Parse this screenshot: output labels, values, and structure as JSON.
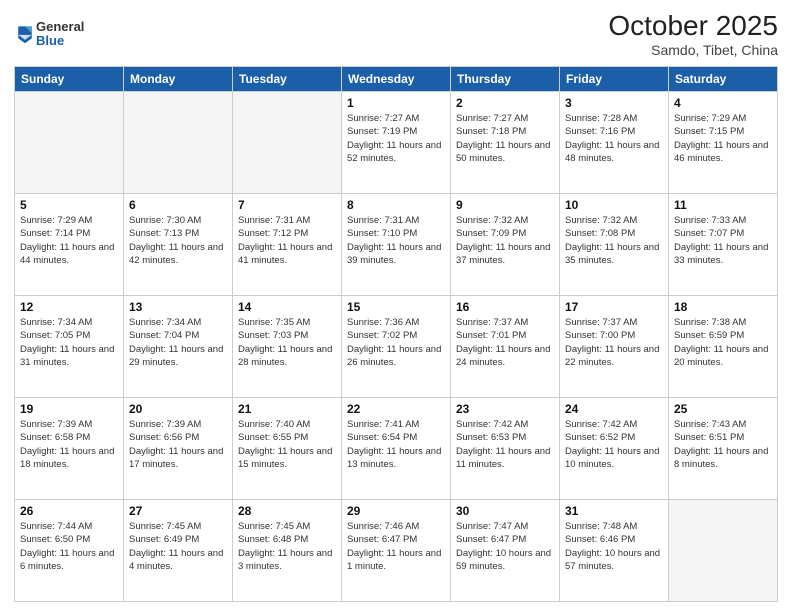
{
  "logo": {
    "general": "General",
    "blue": "Blue"
  },
  "header": {
    "month": "October 2025",
    "location": "Samdo, Tibet, China"
  },
  "weekdays": [
    "Sunday",
    "Monday",
    "Tuesday",
    "Wednesday",
    "Thursday",
    "Friday",
    "Saturday"
  ],
  "weeks": [
    [
      {
        "day": "",
        "empty": true
      },
      {
        "day": "",
        "empty": true
      },
      {
        "day": "",
        "empty": true
      },
      {
        "day": "1",
        "sunrise": "7:27 AM",
        "sunset": "7:19 PM",
        "daylight": "11 hours and 52 minutes."
      },
      {
        "day": "2",
        "sunrise": "7:27 AM",
        "sunset": "7:18 PM",
        "daylight": "11 hours and 50 minutes."
      },
      {
        "day": "3",
        "sunrise": "7:28 AM",
        "sunset": "7:16 PM",
        "daylight": "11 hours and 48 minutes."
      },
      {
        "day": "4",
        "sunrise": "7:29 AM",
        "sunset": "7:15 PM",
        "daylight": "11 hours and 46 minutes."
      }
    ],
    [
      {
        "day": "5",
        "sunrise": "7:29 AM",
        "sunset": "7:14 PM",
        "daylight": "11 hours and 44 minutes."
      },
      {
        "day": "6",
        "sunrise": "7:30 AM",
        "sunset": "7:13 PM",
        "daylight": "11 hours and 42 minutes."
      },
      {
        "day": "7",
        "sunrise": "7:31 AM",
        "sunset": "7:12 PM",
        "daylight": "11 hours and 41 minutes."
      },
      {
        "day": "8",
        "sunrise": "7:31 AM",
        "sunset": "7:10 PM",
        "daylight": "11 hours and 39 minutes."
      },
      {
        "day": "9",
        "sunrise": "7:32 AM",
        "sunset": "7:09 PM",
        "daylight": "11 hours and 37 minutes."
      },
      {
        "day": "10",
        "sunrise": "7:32 AM",
        "sunset": "7:08 PM",
        "daylight": "11 hours and 35 minutes."
      },
      {
        "day": "11",
        "sunrise": "7:33 AM",
        "sunset": "7:07 PM",
        "daylight": "11 hours and 33 minutes."
      }
    ],
    [
      {
        "day": "12",
        "sunrise": "7:34 AM",
        "sunset": "7:05 PM",
        "daylight": "11 hours and 31 minutes."
      },
      {
        "day": "13",
        "sunrise": "7:34 AM",
        "sunset": "7:04 PM",
        "daylight": "11 hours and 29 minutes."
      },
      {
        "day": "14",
        "sunrise": "7:35 AM",
        "sunset": "7:03 PM",
        "daylight": "11 hours and 28 minutes."
      },
      {
        "day": "15",
        "sunrise": "7:36 AM",
        "sunset": "7:02 PM",
        "daylight": "11 hours and 26 minutes."
      },
      {
        "day": "16",
        "sunrise": "7:37 AM",
        "sunset": "7:01 PM",
        "daylight": "11 hours and 24 minutes."
      },
      {
        "day": "17",
        "sunrise": "7:37 AM",
        "sunset": "7:00 PM",
        "daylight": "11 hours and 22 minutes."
      },
      {
        "day": "18",
        "sunrise": "7:38 AM",
        "sunset": "6:59 PM",
        "daylight": "11 hours and 20 minutes."
      }
    ],
    [
      {
        "day": "19",
        "sunrise": "7:39 AM",
        "sunset": "6:58 PM",
        "daylight": "11 hours and 18 minutes."
      },
      {
        "day": "20",
        "sunrise": "7:39 AM",
        "sunset": "6:56 PM",
        "daylight": "11 hours and 17 minutes."
      },
      {
        "day": "21",
        "sunrise": "7:40 AM",
        "sunset": "6:55 PM",
        "daylight": "11 hours and 15 minutes."
      },
      {
        "day": "22",
        "sunrise": "7:41 AM",
        "sunset": "6:54 PM",
        "daylight": "11 hours and 13 minutes."
      },
      {
        "day": "23",
        "sunrise": "7:42 AM",
        "sunset": "6:53 PM",
        "daylight": "11 hours and 11 minutes."
      },
      {
        "day": "24",
        "sunrise": "7:42 AM",
        "sunset": "6:52 PM",
        "daylight": "11 hours and 10 minutes."
      },
      {
        "day": "25",
        "sunrise": "7:43 AM",
        "sunset": "6:51 PM",
        "daylight": "11 hours and 8 minutes."
      }
    ],
    [
      {
        "day": "26",
        "sunrise": "7:44 AM",
        "sunset": "6:50 PM",
        "daylight": "11 hours and 6 minutes."
      },
      {
        "day": "27",
        "sunrise": "7:45 AM",
        "sunset": "6:49 PM",
        "daylight": "11 hours and 4 minutes."
      },
      {
        "day": "28",
        "sunrise": "7:45 AM",
        "sunset": "6:48 PM",
        "daylight": "11 hours and 3 minutes."
      },
      {
        "day": "29",
        "sunrise": "7:46 AM",
        "sunset": "6:47 PM",
        "daylight": "11 hours and 1 minute."
      },
      {
        "day": "30",
        "sunrise": "7:47 AM",
        "sunset": "6:47 PM",
        "daylight": "10 hours and 59 minutes."
      },
      {
        "day": "31",
        "sunrise": "7:48 AM",
        "sunset": "6:46 PM",
        "daylight": "10 hours and 57 minutes."
      },
      {
        "day": "",
        "empty": true
      }
    ]
  ]
}
